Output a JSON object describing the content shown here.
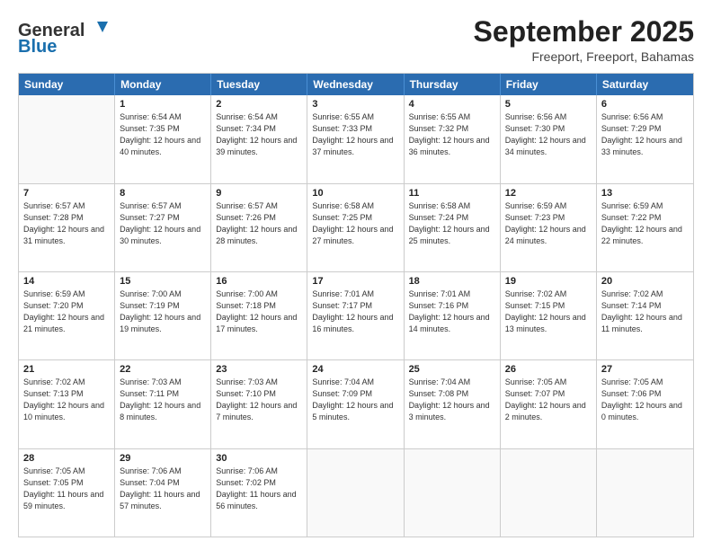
{
  "header": {
    "logo_general": "General",
    "logo_blue": "Blue",
    "month_title": "September 2025",
    "location": "Freeport, Freeport, Bahamas"
  },
  "days_of_week": [
    "Sunday",
    "Monday",
    "Tuesday",
    "Wednesday",
    "Thursday",
    "Friday",
    "Saturday"
  ],
  "weeks": [
    [
      {
        "day": "",
        "empty": true
      },
      {
        "day": "1",
        "sunrise": "Sunrise: 6:54 AM",
        "sunset": "Sunset: 7:35 PM",
        "daylight": "Daylight: 12 hours and 40 minutes."
      },
      {
        "day": "2",
        "sunrise": "Sunrise: 6:54 AM",
        "sunset": "Sunset: 7:34 PM",
        "daylight": "Daylight: 12 hours and 39 minutes."
      },
      {
        "day": "3",
        "sunrise": "Sunrise: 6:55 AM",
        "sunset": "Sunset: 7:33 PM",
        "daylight": "Daylight: 12 hours and 37 minutes."
      },
      {
        "day": "4",
        "sunrise": "Sunrise: 6:55 AM",
        "sunset": "Sunset: 7:32 PM",
        "daylight": "Daylight: 12 hours and 36 minutes."
      },
      {
        "day": "5",
        "sunrise": "Sunrise: 6:56 AM",
        "sunset": "Sunset: 7:30 PM",
        "daylight": "Daylight: 12 hours and 34 minutes."
      },
      {
        "day": "6",
        "sunrise": "Sunrise: 6:56 AM",
        "sunset": "Sunset: 7:29 PM",
        "daylight": "Daylight: 12 hours and 33 minutes."
      }
    ],
    [
      {
        "day": "7",
        "sunrise": "Sunrise: 6:57 AM",
        "sunset": "Sunset: 7:28 PM",
        "daylight": "Daylight: 12 hours and 31 minutes."
      },
      {
        "day": "8",
        "sunrise": "Sunrise: 6:57 AM",
        "sunset": "Sunset: 7:27 PM",
        "daylight": "Daylight: 12 hours and 30 minutes."
      },
      {
        "day": "9",
        "sunrise": "Sunrise: 6:57 AM",
        "sunset": "Sunset: 7:26 PM",
        "daylight": "Daylight: 12 hours and 28 minutes."
      },
      {
        "day": "10",
        "sunrise": "Sunrise: 6:58 AM",
        "sunset": "Sunset: 7:25 PM",
        "daylight": "Daylight: 12 hours and 27 minutes."
      },
      {
        "day": "11",
        "sunrise": "Sunrise: 6:58 AM",
        "sunset": "Sunset: 7:24 PM",
        "daylight": "Daylight: 12 hours and 25 minutes."
      },
      {
        "day": "12",
        "sunrise": "Sunrise: 6:59 AM",
        "sunset": "Sunset: 7:23 PM",
        "daylight": "Daylight: 12 hours and 24 minutes."
      },
      {
        "day": "13",
        "sunrise": "Sunrise: 6:59 AM",
        "sunset": "Sunset: 7:22 PM",
        "daylight": "Daylight: 12 hours and 22 minutes."
      }
    ],
    [
      {
        "day": "14",
        "sunrise": "Sunrise: 6:59 AM",
        "sunset": "Sunset: 7:20 PM",
        "daylight": "Daylight: 12 hours and 21 minutes."
      },
      {
        "day": "15",
        "sunrise": "Sunrise: 7:00 AM",
        "sunset": "Sunset: 7:19 PM",
        "daylight": "Daylight: 12 hours and 19 minutes."
      },
      {
        "day": "16",
        "sunrise": "Sunrise: 7:00 AM",
        "sunset": "Sunset: 7:18 PM",
        "daylight": "Daylight: 12 hours and 17 minutes."
      },
      {
        "day": "17",
        "sunrise": "Sunrise: 7:01 AM",
        "sunset": "Sunset: 7:17 PM",
        "daylight": "Daylight: 12 hours and 16 minutes."
      },
      {
        "day": "18",
        "sunrise": "Sunrise: 7:01 AM",
        "sunset": "Sunset: 7:16 PM",
        "daylight": "Daylight: 12 hours and 14 minutes."
      },
      {
        "day": "19",
        "sunrise": "Sunrise: 7:02 AM",
        "sunset": "Sunset: 7:15 PM",
        "daylight": "Daylight: 12 hours and 13 minutes."
      },
      {
        "day": "20",
        "sunrise": "Sunrise: 7:02 AM",
        "sunset": "Sunset: 7:14 PM",
        "daylight": "Daylight: 12 hours and 11 minutes."
      }
    ],
    [
      {
        "day": "21",
        "sunrise": "Sunrise: 7:02 AM",
        "sunset": "Sunset: 7:13 PM",
        "daylight": "Daylight: 12 hours and 10 minutes."
      },
      {
        "day": "22",
        "sunrise": "Sunrise: 7:03 AM",
        "sunset": "Sunset: 7:11 PM",
        "daylight": "Daylight: 12 hours and 8 minutes."
      },
      {
        "day": "23",
        "sunrise": "Sunrise: 7:03 AM",
        "sunset": "Sunset: 7:10 PM",
        "daylight": "Daylight: 12 hours and 7 minutes."
      },
      {
        "day": "24",
        "sunrise": "Sunrise: 7:04 AM",
        "sunset": "Sunset: 7:09 PM",
        "daylight": "Daylight: 12 hours and 5 minutes."
      },
      {
        "day": "25",
        "sunrise": "Sunrise: 7:04 AM",
        "sunset": "Sunset: 7:08 PM",
        "daylight": "Daylight: 12 hours and 3 minutes."
      },
      {
        "day": "26",
        "sunrise": "Sunrise: 7:05 AM",
        "sunset": "Sunset: 7:07 PM",
        "daylight": "Daylight: 12 hours and 2 minutes."
      },
      {
        "day": "27",
        "sunrise": "Sunrise: 7:05 AM",
        "sunset": "Sunset: 7:06 PM",
        "daylight": "Daylight: 12 hours and 0 minutes."
      }
    ],
    [
      {
        "day": "28",
        "sunrise": "Sunrise: 7:05 AM",
        "sunset": "Sunset: 7:05 PM",
        "daylight": "Daylight: 11 hours and 59 minutes."
      },
      {
        "day": "29",
        "sunrise": "Sunrise: 7:06 AM",
        "sunset": "Sunset: 7:04 PM",
        "daylight": "Daylight: 11 hours and 57 minutes."
      },
      {
        "day": "30",
        "sunrise": "Sunrise: 7:06 AM",
        "sunset": "Sunset: 7:02 PM",
        "daylight": "Daylight: 11 hours and 56 minutes."
      },
      {
        "day": "",
        "empty": true
      },
      {
        "day": "",
        "empty": true
      },
      {
        "day": "",
        "empty": true
      },
      {
        "day": "",
        "empty": true
      }
    ]
  ]
}
